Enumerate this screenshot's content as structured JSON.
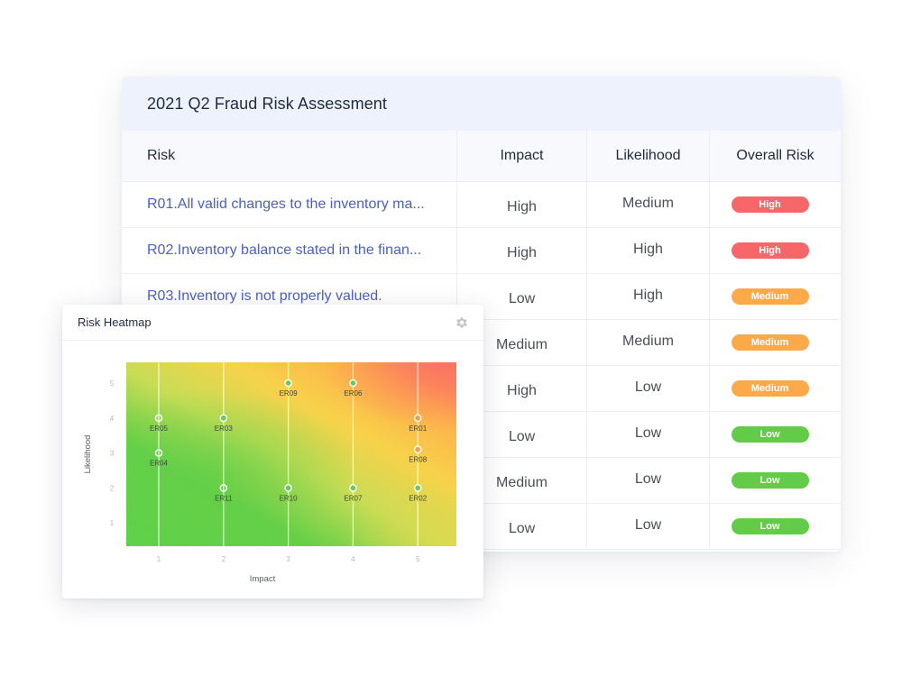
{
  "table": {
    "title": "2021 Q2 Fraud Risk Assessment",
    "columns": [
      "Risk",
      "Impact",
      "Likelihood",
      "Overall Risk"
    ],
    "rows": [
      {
        "risk": "R01.All valid changes to the inventory ma...",
        "impact": "High",
        "likelihood": "Medium",
        "overall": "High"
      },
      {
        "risk": "R02.Inventory balance stated in the finan...",
        "impact": "High",
        "likelihood": "High",
        "overall": "High"
      },
      {
        "risk": "R03.Inventory is not properly valued.",
        "impact": "Low",
        "likelihood": "High",
        "overall": "Medium"
      },
      {
        "risk": "",
        "impact": "Medium",
        "likelihood": "Medium",
        "overall": "Medium"
      },
      {
        "risk": "",
        "impact": "High",
        "likelihood": "Low",
        "overall": "Medium"
      },
      {
        "risk": "",
        "impact": "Low",
        "likelihood": "Low",
        "overall": "Low"
      },
      {
        "risk": "",
        "impact": "Medium",
        "likelihood": "Low",
        "overall": "Low"
      },
      {
        "risk": "",
        "impact": "Low",
        "likelihood": "Low",
        "overall": "Low"
      }
    ],
    "badge_colors": {
      "High": "#f7676a",
      "Medium": "#fca949",
      "Low": "#62cb48"
    }
  },
  "heatmap": {
    "title": "Risk Heatmap",
    "settings_icon": "gear-icon",
    "point_fill_green": "#6acb5a",
    "point_fill_orange": "#f0a24a"
  },
  "chart_data": {
    "type": "scatter",
    "title": "Risk Heatmap",
    "xlabel": "Impact",
    "ylabel": "Likelihood",
    "x_ticks": [
      "1",
      "2",
      "3",
      "4",
      "5"
    ],
    "y_ticks": [
      "1",
      "2",
      "3",
      "4",
      "5"
    ],
    "xlim": [
      0.5,
      5.6
    ],
    "ylim": [
      0.4,
      5.6
    ],
    "background": "gradient green (low impact/likelihood) to yellow to red (high impact/likelihood)",
    "points": [
      {
        "label": "ER05",
        "x": 1,
        "y": 4,
        "style": "hollow"
      },
      {
        "label": "ER04",
        "x": 1,
        "y": 3,
        "style": "hollow"
      },
      {
        "label": "ER03",
        "x": 2,
        "y": 4,
        "style": "filled"
      },
      {
        "label": "ER11",
        "x": 2,
        "y": 2,
        "style": "hollow"
      },
      {
        "label": "ER09",
        "x": 3,
        "y": 5,
        "style": "filled"
      },
      {
        "label": "ER10",
        "x": 3,
        "y": 2,
        "style": "filled"
      },
      {
        "label": "ER06",
        "x": 4,
        "y": 5,
        "style": "filled"
      },
      {
        "label": "ER07",
        "x": 4,
        "y": 2,
        "style": "filled"
      },
      {
        "label": "ER01",
        "x": 5,
        "y": 4,
        "style": "hollow"
      },
      {
        "label": "ER08",
        "x": 5,
        "y": 3.1,
        "style": "hollow"
      },
      {
        "label": "ER02",
        "x": 5,
        "y": 2,
        "style": "filled"
      }
    ]
  }
}
